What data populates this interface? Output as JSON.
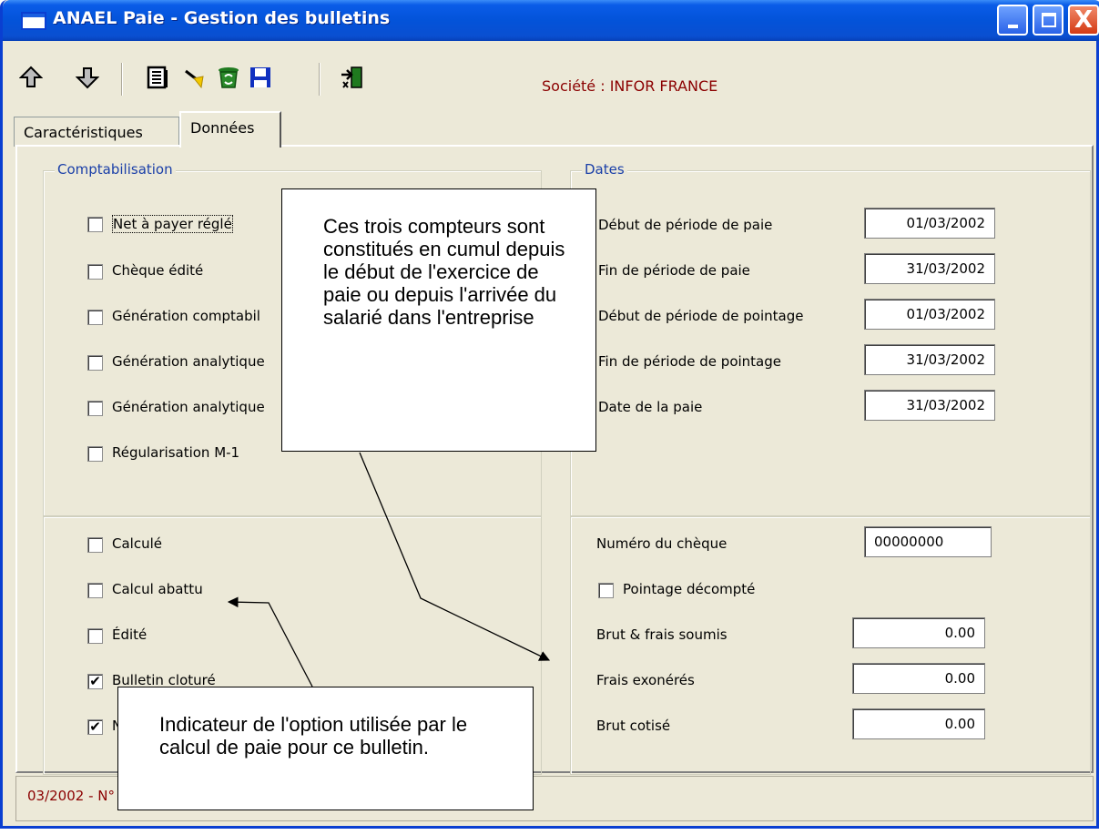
{
  "window": {
    "title": "ANAEL Paie - Gestion des bulletins",
    "controls": {
      "minimize": "minimize",
      "maximize": "maximize",
      "close": "X"
    }
  },
  "toolbar": {
    "icons": [
      "arrow-up-icon",
      "arrow-down-icon",
      "list-icon",
      "edit-arrow-icon",
      "recycle-icon",
      "save-icon",
      "exit-door-icon"
    ],
    "societe": "Société : INFOR FRANCE"
  },
  "tabs": [
    {
      "label": "Caractéristiques",
      "active": false
    },
    {
      "label": "Données",
      "active": true
    }
  ],
  "comptabilisation": {
    "legend": "Comptabilisation",
    "items": [
      {
        "label": "Net à payer réglé",
        "checked": false
      },
      {
        "label": "Chèque édité",
        "checked": false
      },
      {
        "label": "Génération comptabil",
        "checked": false
      },
      {
        "label": "Génération analytique",
        "checked": false
      },
      {
        "label": "Génération analytique",
        "checked": false
      },
      {
        "label": "Régularisation M-1",
        "checked": false
      }
    ]
  },
  "etat": {
    "items": [
      {
        "label": "Calculé",
        "checked": false
      },
      {
        "label": "Calcul abattu",
        "checked": false
      },
      {
        "label": "Édité",
        "checked": false
      },
      {
        "label": "Bulletin cloturé",
        "checked": true
      },
      {
        "label": "N",
        "checked": true
      }
    ]
  },
  "dates": {
    "legend": "Dates",
    "fields": [
      {
        "label": "Début de période de paie",
        "value": "01/03/2002"
      },
      {
        "label": "Fin de période de paie",
        "value": "31/03/2002"
      },
      {
        "label": "Début de période de pointage",
        "value": "01/03/2002"
      },
      {
        "label": "Fin de période de pointage",
        "value": "31/03/2002"
      },
      {
        "label": "Date de la paie",
        "value": "31/03/2002"
      }
    ]
  },
  "paiement": {
    "numero_cheque_label": "Numéro du chèque",
    "numero_cheque": "00000000",
    "pointage_label": "Pointage décompté",
    "pointage_checked": false,
    "montants": [
      {
        "label": "Brut & frais soumis",
        "value": "0.00"
      },
      {
        "label": "Frais exonérés",
        "value": "0.00"
      },
      {
        "label": "Brut cotisé",
        "value": "0.00"
      }
    ]
  },
  "statusbar": {
    "text": "03/2002 - N° 000001 - [000001] POTTER HUGO"
  },
  "callouts": [
    {
      "text": "Ces trois compteurs sont constitués en cumul depuis le début de l'exercice de paie ou depuis l'arrivée du salarié dans l'entreprise"
    },
    {
      "text": "Indicateur de l'option utilisée par le calcul de paie pour ce bulletin."
    }
  ]
}
